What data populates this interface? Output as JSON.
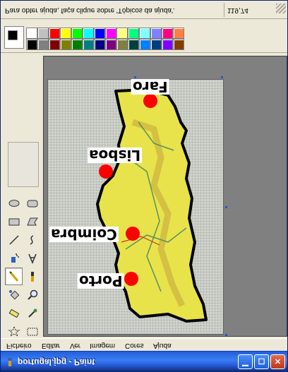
{
  "window": {
    "title": "portugal.jpg - Paint",
    "icon": "paint-app-icon"
  },
  "status": {
    "help_text": "Para obter ajuda, faça clique sobre 'Tópicos da ajuda'.",
    "coords": "119,74"
  },
  "menu": {
    "items": [
      "Ficheiro",
      "Editar",
      "Ver",
      "Imagem",
      "Cores",
      "Ajuda"
    ]
  },
  "palette": {
    "foreground": "#000000",
    "background": "#ffffff",
    "row1": [
      "#ffffff",
      "#c0c0c0",
      "#ff0000",
      "#ffff00",
      "#00ff00",
      "#00ffff",
      "#0000ff",
      "#ff00ff",
      "#ffff80",
      "#00ff80",
      "#80ffff",
      "#8080ff",
      "#ff0080",
      "#ff8040"
    ],
    "row2": [
      "#000000",
      "#808080",
      "#800000",
      "#808000",
      "#008000",
      "#008080",
      "#000080",
      "#800080",
      "#808040",
      "#004040",
      "#0080ff",
      "#004080",
      "#8000ff",
      "#804000"
    ]
  },
  "tools": [
    {
      "name": "ellipse-tool",
      "icon": "ellipse-icon"
    },
    {
      "name": "rounded-rect-tool",
      "icon": "rounded-rect-icon"
    },
    {
      "name": "rectangle-tool",
      "icon": "rectangle-icon"
    },
    {
      "name": "polygon-tool",
      "icon": "polygon-icon"
    },
    {
      "name": "line-tool",
      "icon": "line-icon"
    },
    {
      "name": "curve-tool",
      "icon": "curve-icon"
    },
    {
      "name": "airbrush-tool",
      "icon": "airbrush-icon"
    },
    {
      "name": "text-tool",
      "icon": "text-a-icon"
    },
    {
      "name": "pencil-tool",
      "icon": "pencil-icon"
    },
    {
      "name": "brush-tool",
      "icon": "brush-icon"
    },
    {
      "name": "fill-tool",
      "icon": "fill-bucket-icon"
    },
    {
      "name": "magnifier-tool",
      "icon": "magnifier-icon"
    },
    {
      "name": "eraser-tool",
      "icon": "eraser-icon"
    },
    {
      "name": "color-picker-tool",
      "icon": "color-picker-icon"
    },
    {
      "name": "free-select-tool",
      "icon": "star-select-icon"
    },
    {
      "name": "select-tool",
      "icon": "rect-select-icon"
    }
  ],
  "map": {
    "labels": [
      "Faro",
      "Lisboa",
      "Coimbra",
      "Porto"
    ],
    "marker_color": "#ff0000"
  }
}
